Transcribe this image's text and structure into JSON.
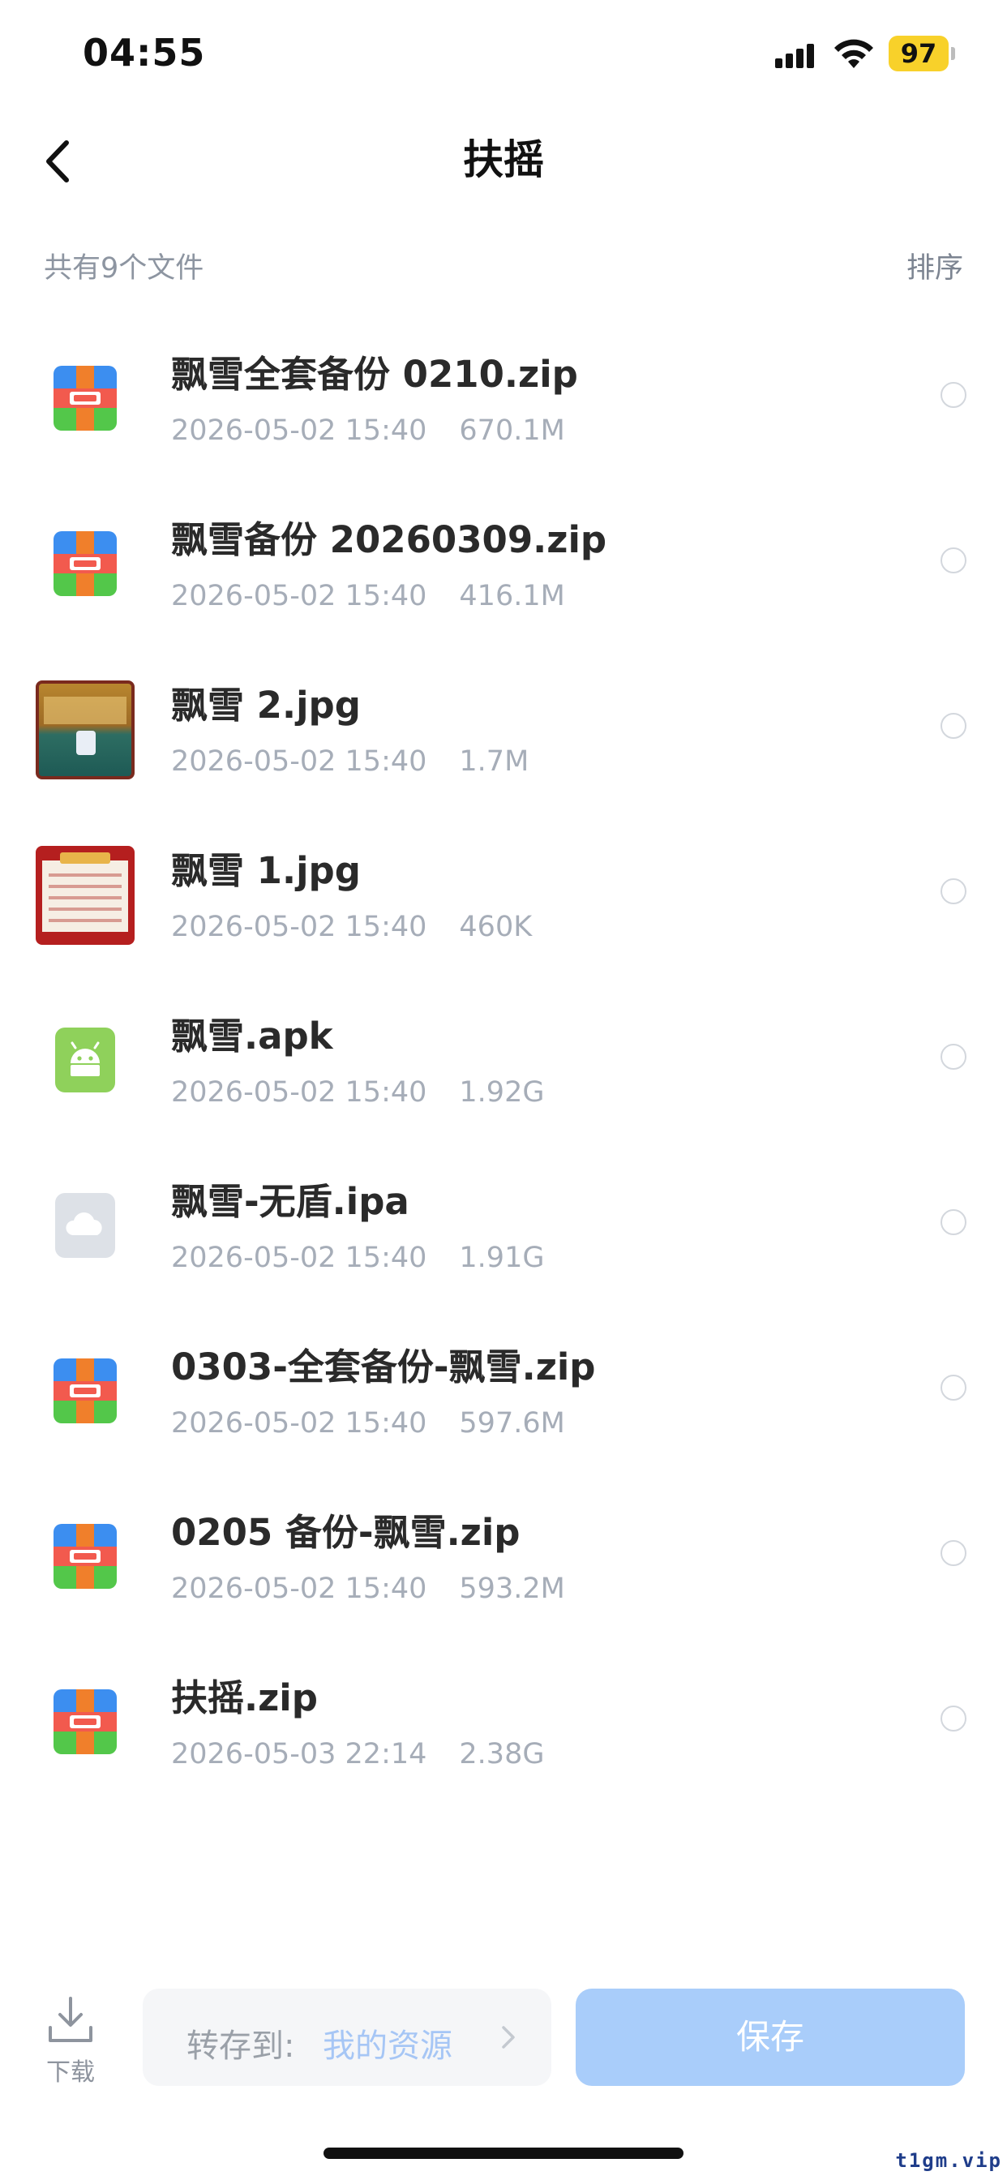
{
  "status_bar": {
    "time": "04:55",
    "battery": "97"
  },
  "nav": {
    "title": "扶摇"
  },
  "summary": {
    "count_text": "共有9个文件",
    "sort_label": "排序"
  },
  "files": [
    {
      "name": "飘雪全套备份 0210.zip",
      "date": "2026-05-02 15:40",
      "size": "670.1M",
      "type": "zip"
    },
    {
      "name": "飘雪备份 20260309.zip",
      "date": "2026-05-02 15:40",
      "size": "416.1M",
      "type": "zip"
    },
    {
      "name": "飘雪 2.jpg",
      "date": "2026-05-02 15:40",
      "size": "1.7M",
      "type": "image"
    },
    {
      "name": "飘雪 1.jpg",
      "date": "2026-05-02 15:40",
      "size": "460K",
      "type": "image"
    },
    {
      "name": "飘雪.apk",
      "date": "2026-05-02 15:40",
      "size": "1.92G",
      "type": "apk"
    },
    {
      "name": "飘雪-无盾.ipa",
      "date": "2026-05-02 15:40",
      "size": "1.91G",
      "type": "ipa"
    },
    {
      "name": "0303-全套备份-飘雪.zip",
      "date": "2026-05-02 15:40",
      "size": "597.6M",
      "type": "zip"
    },
    {
      "name": "0205 备份-飘雪.zip",
      "date": "2026-05-02 15:40",
      "size": "593.2M",
      "type": "zip"
    },
    {
      "name": "扶摇.zip",
      "date": "2026-05-03 22:14",
      "size": "2.38G",
      "type": "zip"
    }
  ],
  "bottom_bar": {
    "download_label": "下载",
    "save_to_label": "转存到:",
    "save_to_destination": "我的资源",
    "save_button": "保存"
  },
  "watermark": "t1gm.vip",
  "colors": {
    "accent": "#a9cdfa",
    "destination_text": "#a6c6f5",
    "meta_text": "#a6adb8"
  }
}
